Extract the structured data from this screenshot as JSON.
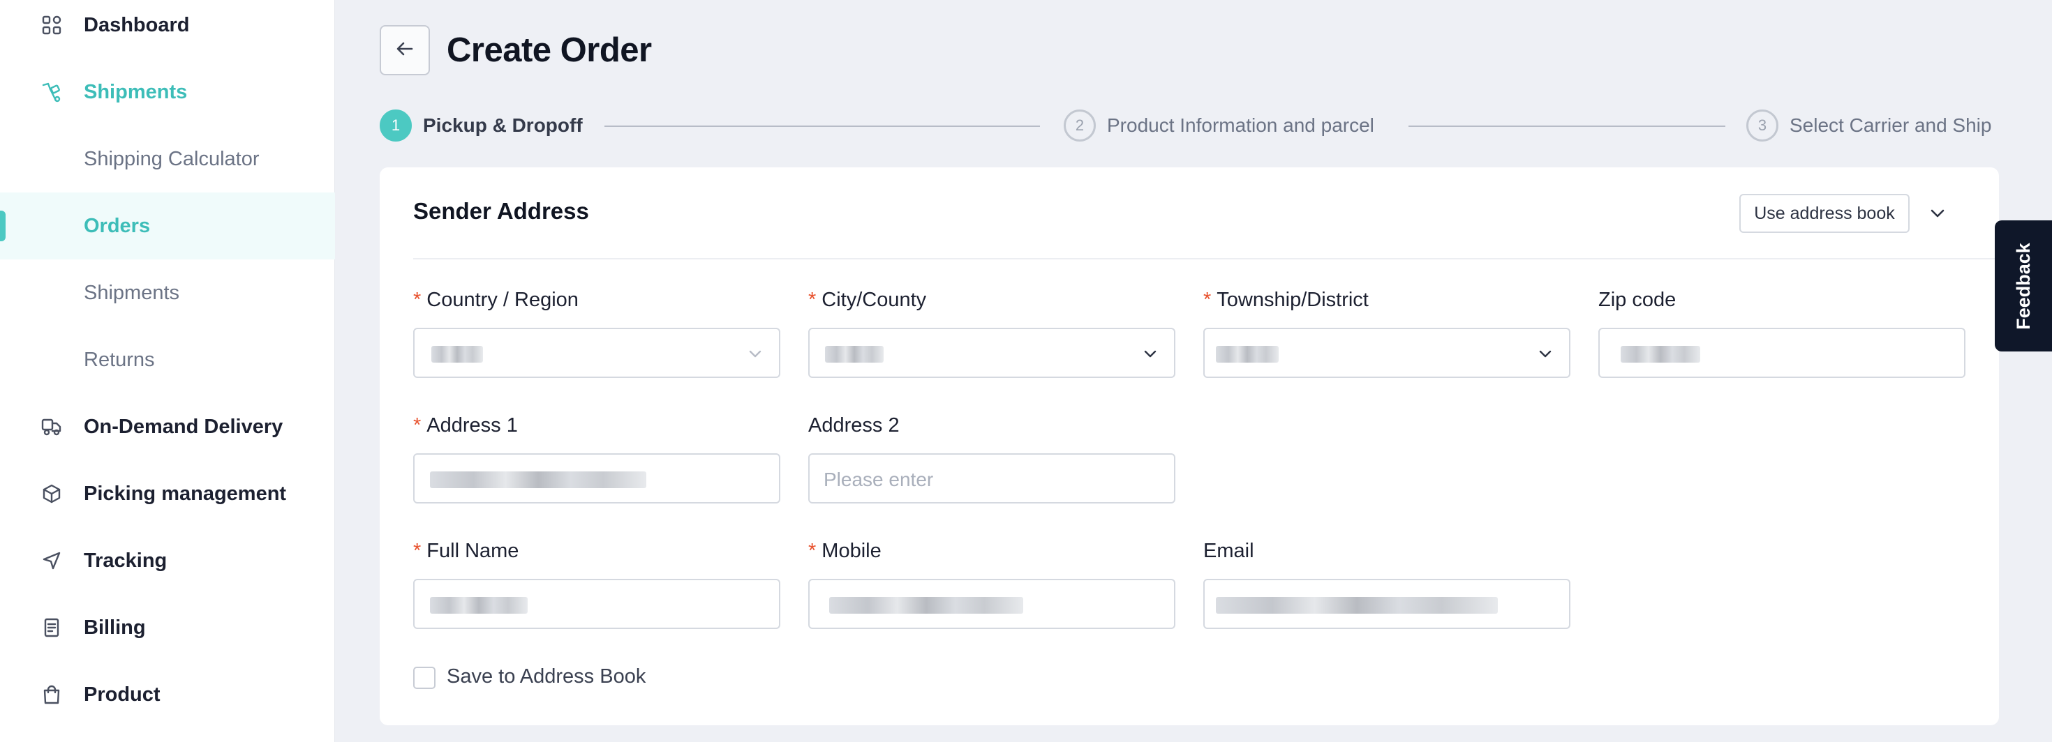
{
  "sidebar": {
    "items": [
      {
        "label": "Dashboard",
        "icon": "dashboard-icon"
      },
      {
        "label": "Shipments",
        "icon": "shipments-icon"
      },
      {
        "label": "Shipping Calculator"
      },
      {
        "label": "Orders"
      },
      {
        "label": "Shipments"
      },
      {
        "label": "Returns"
      },
      {
        "label": "On-Demand Delivery",
        "icon": "delivery-truck-icon"
      },
      {
        "label": "Picking management",
        "icon": "package-icon"
      },
      {
        "label": "Tracking",
        "icon": "navigation-arrow-icon"
      },
      {
        "label": "Billing",
        "icon": "receipt-icon"
      },
      {
        "label": "Product",
        "icon": "shopping-bag-icon"
      }
    ],
    "active_section": "Shipments",
    "selected_item": "Orders"
  },
  "header": {
    "title": "Create Order",
    "back_icon": "arrow-left-icon"
  },
  "stepper": {
    "steps": [
      {
        "number": "1",
        "label": "Pickup & Dropoff",
        "active": true
      },
      {
        "number": "2",
        "label": "Product Information and parcel",
        "active": false
      },
      {
        "number": "3",
        "label": "Select Carrier and Ship",
        "active": false
      }
    ]
  },
  "sender": {
    "title": "Sender Address",
    "address_book_button": "Use address book",
    "fields": {
      "country": {
        "label": "Country / Region",
        "required": true
      },
      "city": {
        "label": "City/County",
        "required": true
      },
      "township": {
        "label": "Township/District",
        "required": true
      },
      "zip": {
        "label": "Zip code",
        "required": false
      },
      "address1": {
        "label": "Address 1",
        "required": true
      },
      "address2": {
        "label": "Address 2",
        "required": false,
        "placeholder": "Please enter"
      },
      "full_name": {
        "label": "Full Name",
        "required": true
      },
      "mobile": {
        "label": "Mobile",
        "required": true
      },
      "email": {
        "label": "Email",
        "required": false
      }
    },
    "save_checkbox_label": "Save to Address Book",
    "required_marker": "*"
  },
  "feedback_tab": "Feedback",
  "colors": {
    "accent": "#4cc9c2",
    "accent_text": "#3dbdb8",
    "required": "#e8532f",
    "page_bg": "#eef0f5",
    "feedback_bg": "#0f1729"
  }
}
